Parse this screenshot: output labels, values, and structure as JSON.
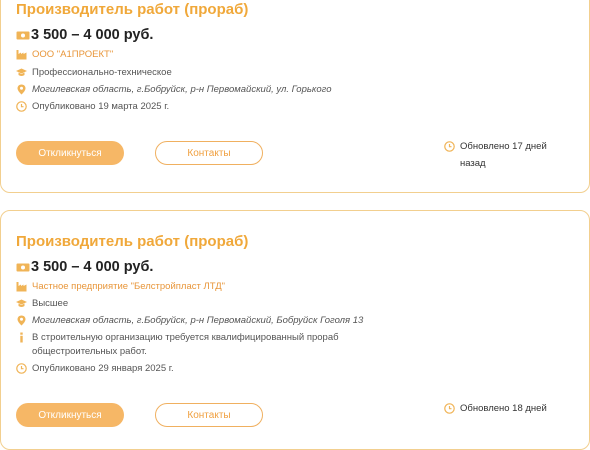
{
  "colors": {
    "accent": "#f0a83a",
    "icon": "#f0b457",
    "button_fill": "#f6b766",
    "border": "#f2cf8f"
  },
  "icons": {
    "salary": "money-icon",
    "company": "factory-icon",
    "education": "graduation-cap-icon",
    "location": "map-pin-icon",
    "info": "info-icon",
    "published": "clock-icon",
    "updated": "clock-icon"
  },
  "vacancies": [
    {
      "title": "Производитель работ (прораб)",
      "salary": "3 500 – 4 000 руб.",
      "company": "ООО \"А1ПРОЕКТ\"",
      "education": "Профессионально-техническое",
      "location": "Могилевская область, г.Бобруйск, р-н Первомайский, ул. Горького",
      "published": "Опубликовано 19 марта 2025 г.",
      "respond_label": "Откликнуться",
      "contacts_label": "Контакты",
      "updated": "Обновлено 17 дней назад"
    },
    {
      "title": "Производитель работ (прораб)",
      "salary": "3 500 – 4 000 руб.",
      "company": "Частное предприятие \"Белстройпласт ЛТД\"",
      "education": "Высшее",
      "location": "Могилевская область, г.Бобруйск, р-н Первомайский, Бобруйск Гоголя 13",
      "description": "В строительную организацию требуется квалифицированный прораб общестроительных работ.",
      "published": "Опубликовано 29 января 2025 г.",
      "respond_label": "Откликнуться",
      "contacts_label": "Контакты",
      "updated": "Обновлено 18 дней"
    }
  ]
}
